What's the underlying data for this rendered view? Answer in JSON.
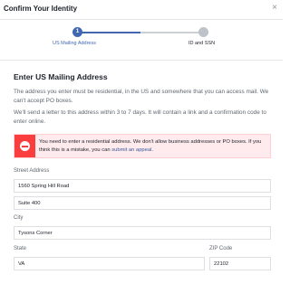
{
  "dialog": {
    "title": "Confirm Your Identity",
    "close_glyph": "×"
  },
  "stepper": {
    "steps": [
      {
        "number": "1",
        "label": "US Mailing Address",
        "state": "active"
      },
      {
        "number": "",
        "label": "ID and SSN",
        "state": "pending"
      }
    ],
    "colors": {
      "active": "#4267b2",
      "pending": "#bec3c9"
    }
  },
  "main": {
    "heading": "Enter US Mailing Address",
    "paragraph_1": "The address you enter must be residential, in the US and somewhere that you can access mail. We can't accept PO boxes.",
    "paragraph_2": "We'll send a letter to this address within 3 to 7 days. It will contain a link and a confirmation code to enter online."
  },
  "alert": {
    "icon": "no-entry-icon",
    "text": "You need to enter a residential address. We don't allow business addresses or PO boxes. If you think this is a mistake, you can ",
    "link": "submit an appeal",
    "text_end": ".",
    "color": "#fa3e3e"
  },
  "form": {
    "street_label": "Street Address",
    "street_line1": "1560 Spring Hill Road",
    "street_line2": "Suite 400",
    "city_label": "City",
    "city": "Tysons Corner",
    "state_label": "State",
    "state": "VA",
    "zip_label": "ZIP Code",
    "zip": "22102"
  }
}
